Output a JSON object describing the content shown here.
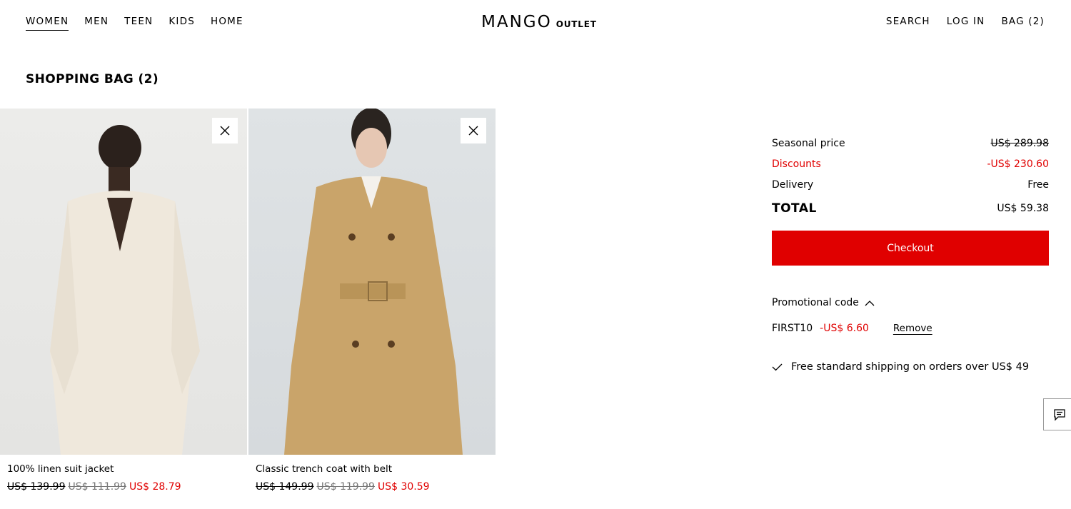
{
  "header": {
    "nav_left": [
      "WOMEN",
      "MEN",
      "TEEN",
      "KIDS",
      "HOME"
    ],
    "logo_main": "MANGO",
    "logo_sub": "OUTLET",
    "search": "SEARCH",
    "login": "LOG IN",
    "bag": "BAG (2)"
  },
  "page": {
    "title": "SHOPPING BAG (2)"
  },
  "products": [
    {
      "name": "100% linen suit jacket",
      "price_original": "US$ 139.99",
      "price_sale": "US$ 111.99",
      "price_final": "US$ 28.79"
    },
    {
      "name": "Classic trench coat with belt",
      "price_original": "US$ 149.99",
      "price_sale": "US$ 119.99",
      "price_final": "US$ 30.59"
    }
  ],
  "summary": {
    "seasonal_label": "Seasonal price",
    "seasonal_value": "US$ 289.98",
    "discounts_label": "Discounts",
    "discounts_value": "-US$ 230.60",
    "delivery_label": "Delivery",
    "delivery_value": "Free",
    "total_label": "TOTAL",
    "total_value": "US$ 59.38",
    "checkout_label": "Checkout",
    "promo_label": "Promotional code",
    "promo_code": "FIRST10",
    "promo_amount": "-US$ 6.60",
    "promo_remove": "Remove",
    "shipping_note": "Free standard shipping on orders over US$ 49"
  },
  "colors": {
    "accent": "#e00000",
    "text": "#000000"
  },
  "icons": {
    "remove": "close-icon",
    "promo_toggle": "chevron-up-icon",
    "shipping": "check-icon",
    "chat": "chat-icon"
  }
}
